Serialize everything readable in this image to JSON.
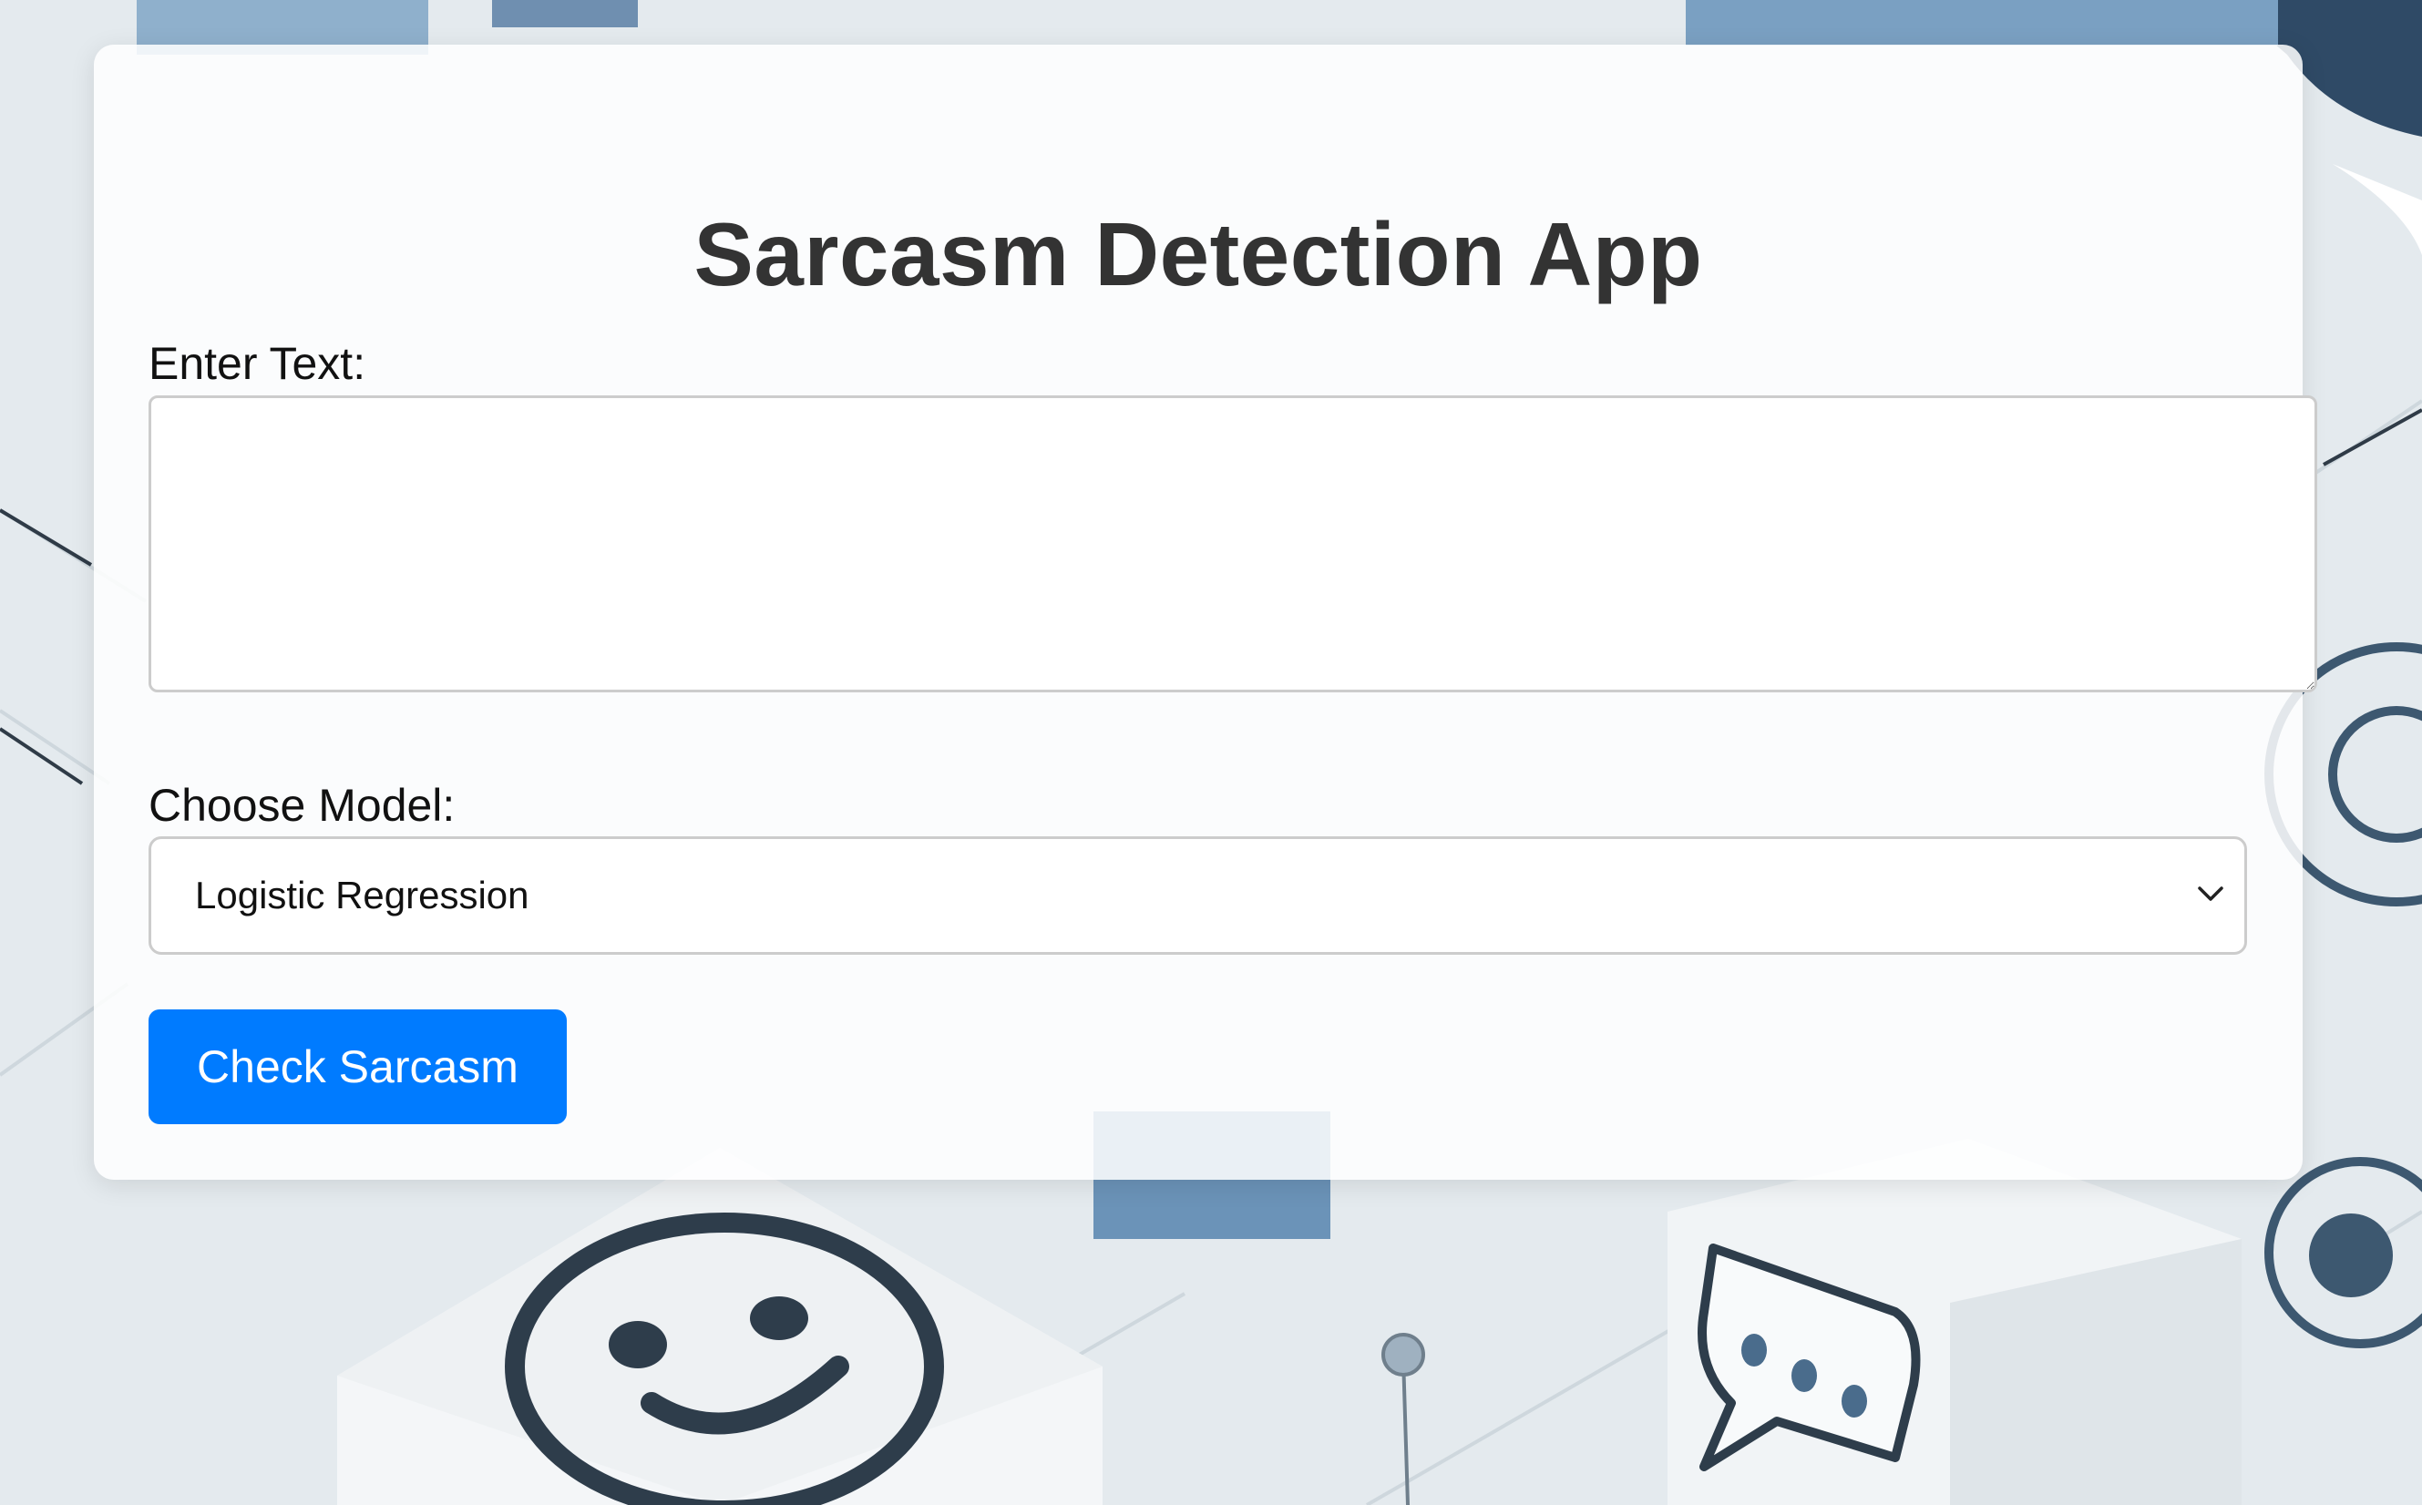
{
  "app": {
    "title": "Sarcasm Detection App"
  },
  "form": {
    "text_label": "Enter Text:",
    "text_value": "",
    "model_label": "Choose Model:",
    "model_selected": "Logistic Regression",
    "submit_label": "Check Sarcasm"
  },
  "colors": {
    "button": "#007bff",
    "title": "#333333"
  }
}
